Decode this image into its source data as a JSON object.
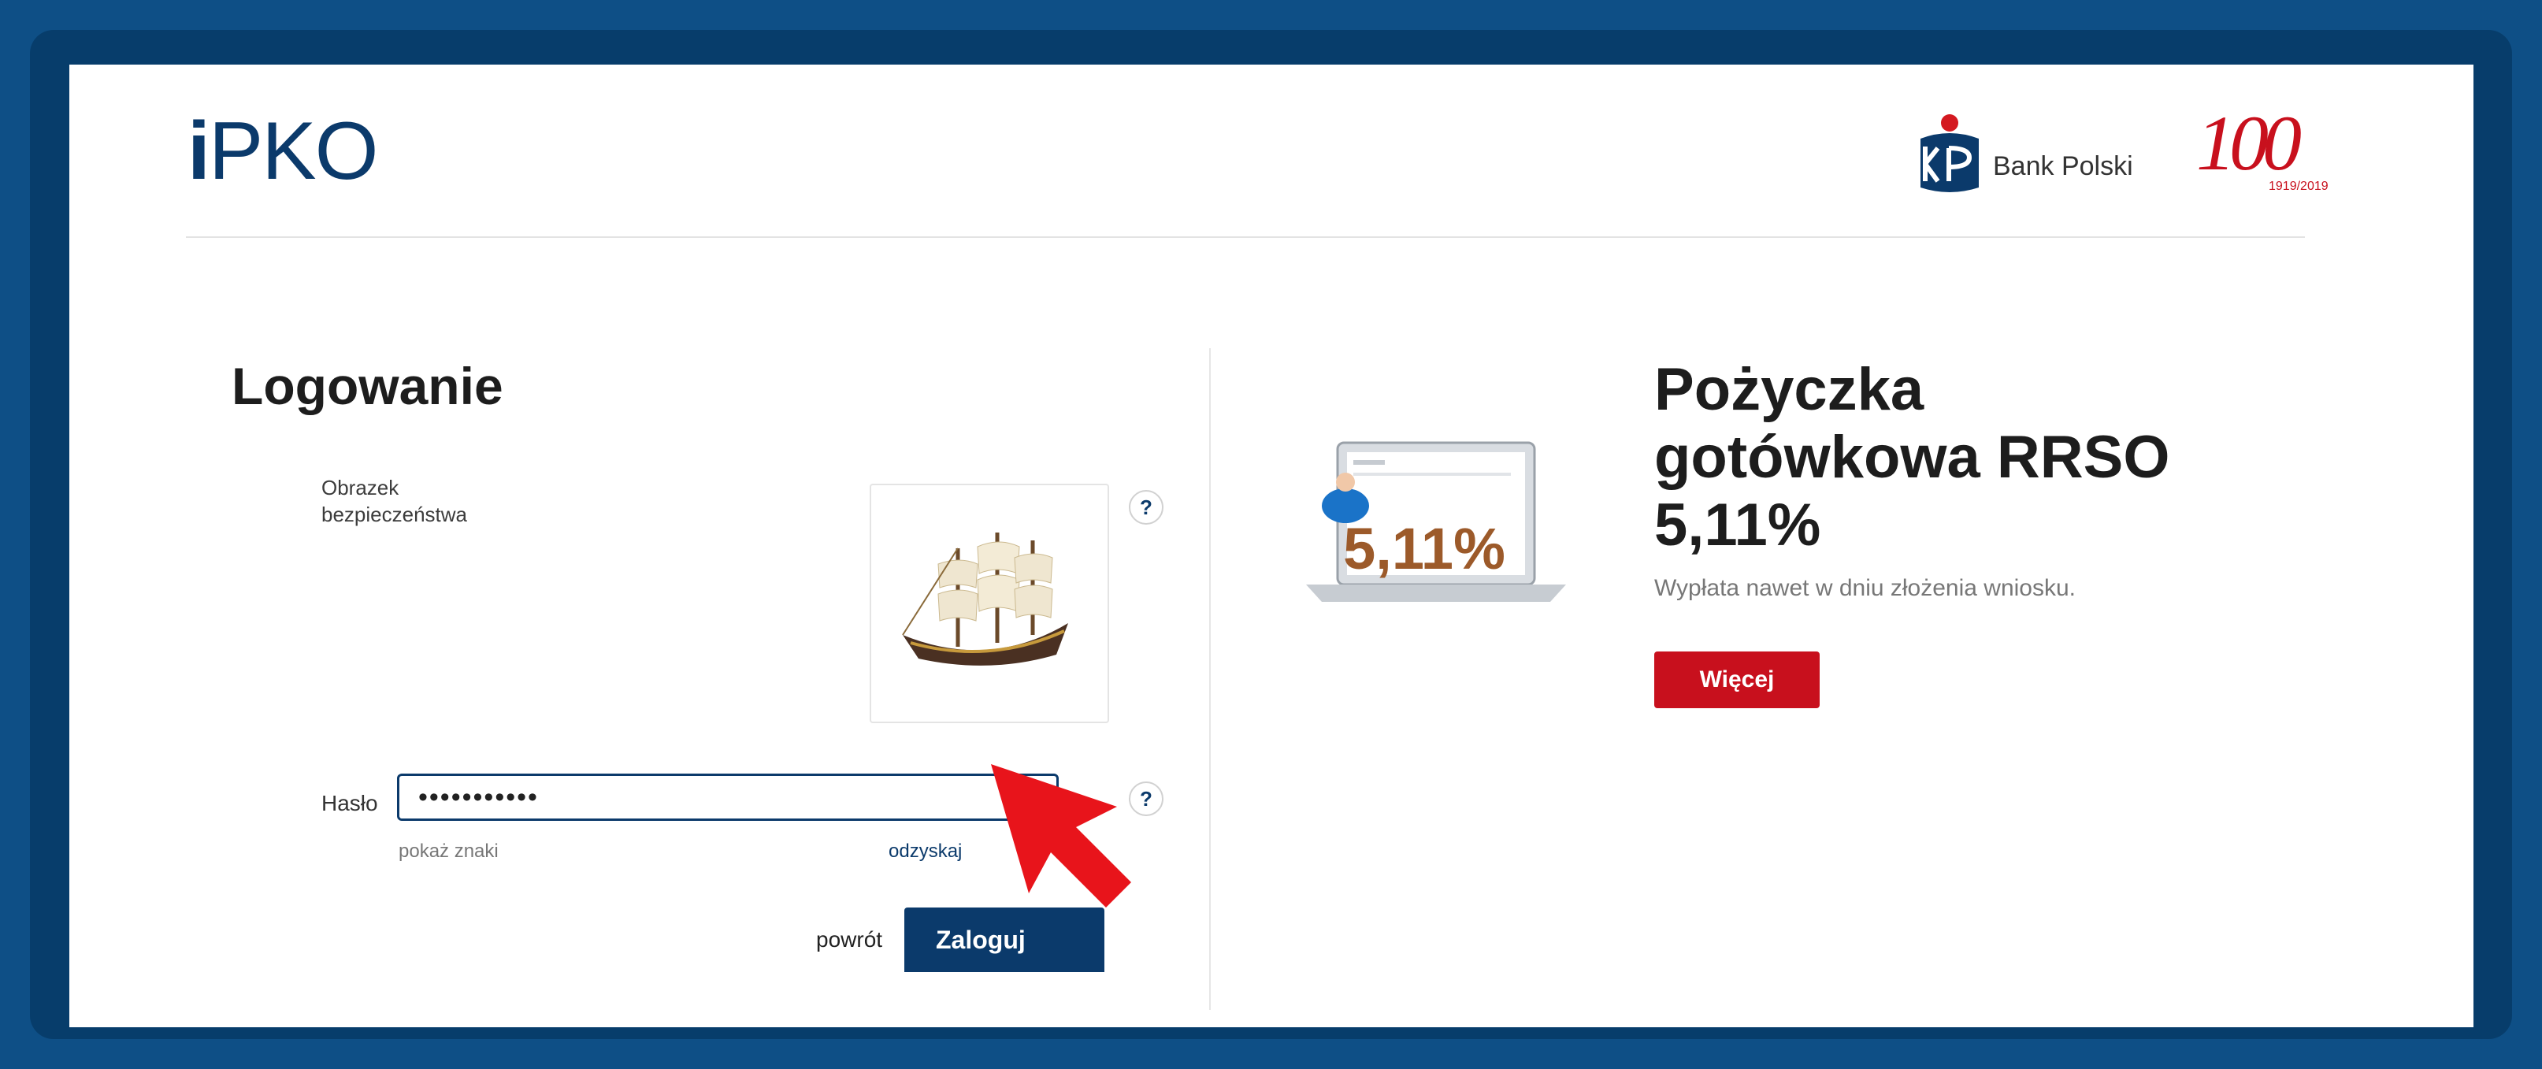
{
  "brand": {
    "app_logo_i": "i",
    "app_logo_text": "PKO",
    "bank_name": "Bank Polski",
    "jubilee_number": "100",
    "jubilee_years": "1919/2019"
  },
  "login": {
    "title": "Logowanie",
    "security_image_label": "Obrazek bezpieczeństwa",
    "help_label": "?",
    "password_label": "Hasło",
    "password_value": "•••••••••••",
    "show_chars_link": "pokaż znaki",
    "recover_link": "odzyskaj",
    "back_link": "powrót",
    "submit_button": "Zaloguj"
  },
  "promo": {
    "title_line1": "Pożyczka",
    "title_line2": "gotówkowa RRSO",
    "title_line3": "5,11%",
    "subtitle": "Wypłata nawet w dniu złożenia wniosku.",
    "button": "Więcej",
    "illustration_value": "5,11%"
  },
  "colors": {
    "outer_background": "#0e4f86",
    "brand_navy": "#0b3a6b",
    "accent_red": "#c8101d"
  },
  "icons": [
    "pko-emblem-icon",
    "help-icon",
    "ship-icon",
    "cursor-arrow-icon"
  ]
}
